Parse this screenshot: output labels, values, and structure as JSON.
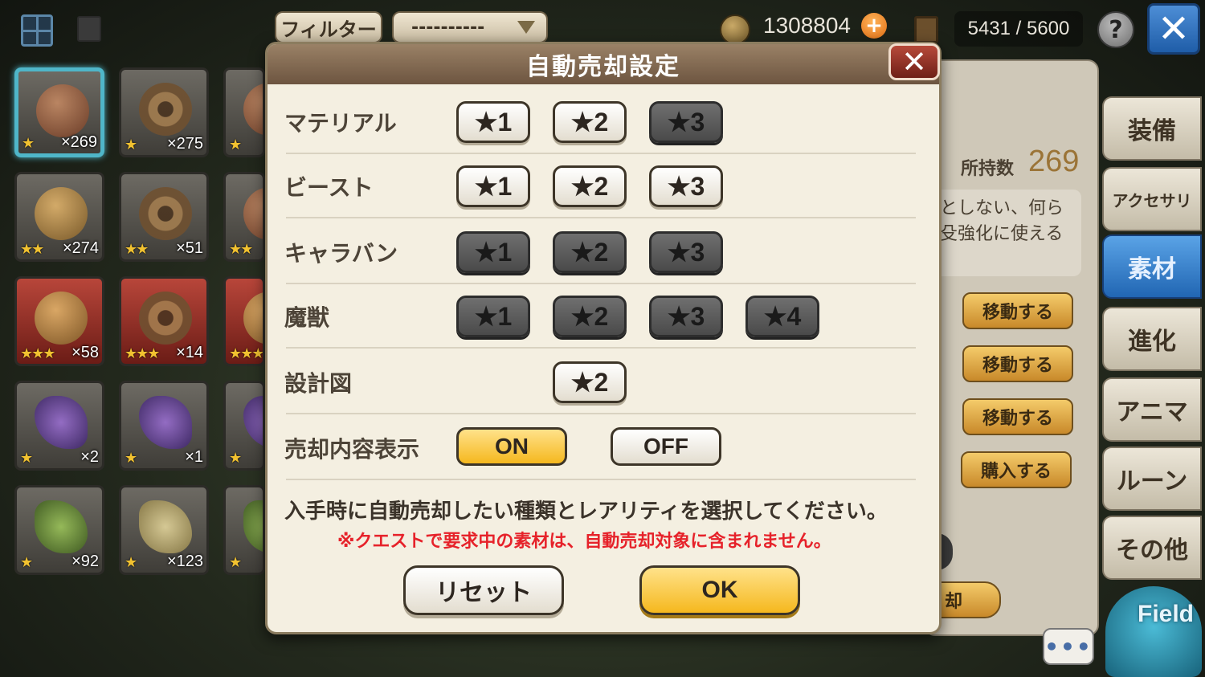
{
  "topbar": {
    "filter_label": "フィルター",
    "filter_value": "----------",
    "coins": "1308804",
    "capacity": "5431 / 5600",
    "help": "?"
  },
  "inventory": [
    {
      "stars": "★",
      "count": "×269",
      "art": "rust",
      "bg": "g",
      "selected": true
    },
    {
      "stars": "★",
      "count": "×275",
      "art": "gear",
      "bg": "g"
    },
    {
      "stars": "★",
      "count": "",
      "art": "rust",
      "bg": "g"
    },
    {
      "stars": "★★",
      "count": "×274",
      "art": "brass",
      "bg": "g"
    },
    {
      "stars": "★★",
      "count": "×51",
      "art": "gear",
      "bg": "g"
    },
    {
      "stars": "★★",
      "count": "",
      "art": "rust",
      "bg": "g"
    },
    {
      "stars": "★★★",
      "count": "×58",
      "art": "brass",
      "bg": "r"
    },
    {
      "stars": "★★★",
      "count": "×14",
      "art": "gear",
      "bg": "r"
    },
    {
      "stars": "★★★",
      "count": "",
      "art": "brass",
      "bg": "r"
    },
    {
      "stars": "★",
      "count": "×2",
      "art": "purple",
      "bg": "g"
    },
    {
      "stars": "★",
      "count": "×1",
      "art": "purple",
      "bg": "g"
    },
    {
      "stars": "★",
      "count": "",
      "art": "purple",
      "bg": "g"
    },
    {
      "stars": "★",
      "count": "×92",
      "art": "green",
      "bg": "g"
    },
    {
      "stars": "★",
      "count": "×123",
      "art": "wheat",
      "bg": "g"
    },
    {
      "stars": "★",
      "count": "",
      "art": "green",
      "bg": "g"
    }
  ],
  "detail": {
    "owned_label": "所持数",
    "owned_value": "269",
    "description": "としない、何ら\n殳強化に使える",
    "actions": [
      "移動する",
      "移動する",
      "移動する",
      "購入する"
    ],
    "sell_label": "却"
  },
  "tabs": [
    {
      "label": "装備",
      "active": false
    },
    {
      "label": "アクセサリ",
      "active": false
    },
    {
      "label": "素材",
      "active": true
    },
    {
      "label": "進化",
      "active": false
    },
    {
      "label": "アニマ",
      "active": false
    },
    {
      "label": "ルーン",
      "active": false
    },
    {
      "label": "その他",
      "active": false
    }
  ],
  "field_label": "Field",
  "chat_label": "•••",
  "modal": {
    "title": "自動売却設定",
    "rows": [
      {
        "label": "マテリアル",
        "buttons": [
          {
            "label": "★1",
            "on": true
          },
          {
            "label": "★2",
            "on": true
          },
          {
            "label": "★3",
            "on": false
          }
        ]
      },
      {
        "label": "ビースト",
        "buttons": [
          {
            "label": "★1",
            "on": true
          },
          {
            "label": "★2",
            "on": true
          },
          {
            "label": "★3",
            "on": true
          }
        ]
      },
      {
        "label": "キャラバン",
        "buttons": [
          {
            "label": "★1",
            "on": false
          },
          {
            "label": "★2",
            "on": false
          },
          {
            "label": "★3",
            "on": false
          }
        ]
      },
      {
        "label": "魔獣",
        "buttons": [
          {
            "label": "★1",
            "on": false
          },
          {
            "label": "★2",
            "on": false
          },
          {
            "label": "★3",
            "on": false
          },
          {
            "label": "★4",
            "on": false
          }
        ]
      },
      {
        "label": "設計図",
        "buttons": [
          {
            "label": "★2",
            "on": true,
            "slot": 1
          }
        ]
      }
    ],
    "display_label": "売却内容表示",
    "on_label": "ON",
    "off_label": "OFF",
    "display_on": true,
    "instruction": "入手時に自動売却したい種類とレアリティを選択してください。",
    "warning": "※クエストで要求中の素材は、自動売却対象に含まれません。",
    "reset_label": "リセット",
    "ok_label": "OK"
  }
}
